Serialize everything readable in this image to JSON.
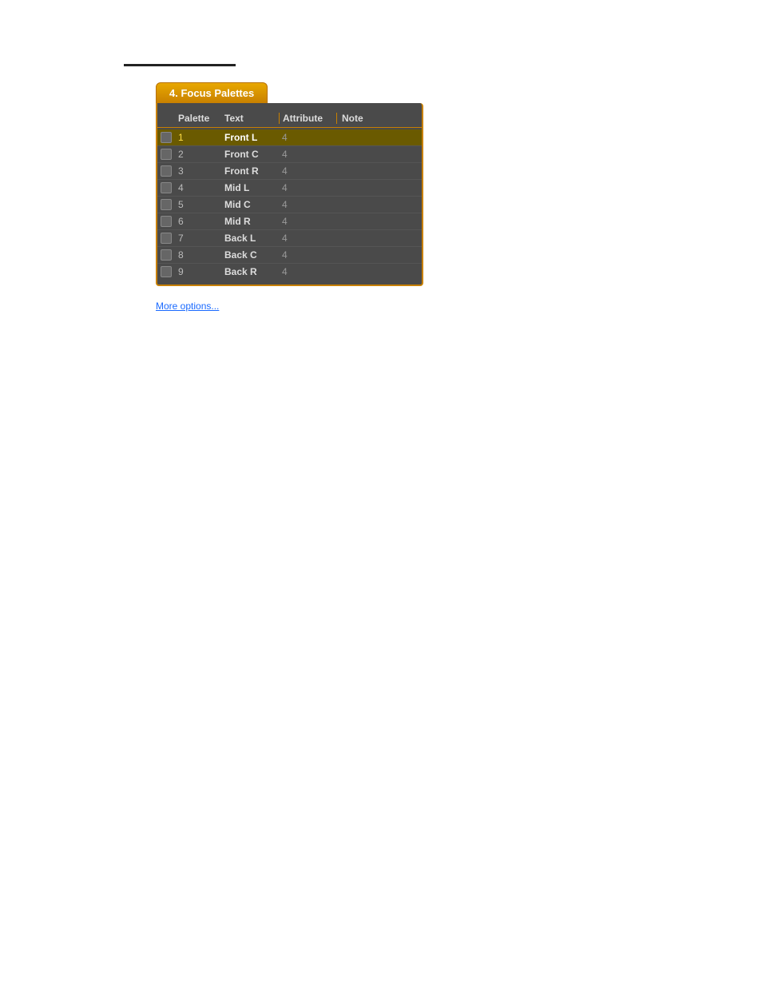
{
  "page": {
    "background_color": "#ffffff"
  },
  "panel": {
    "tab_label": "4. Focus Palettes",
    "columns": {
      "palette": "Palette",
      "text": "Text",
      "attribute": "Attribute",
      "note": "Note"
    },
    "rows": [
      {
        "id": 1,
        "palette": "1",
        "text": "Front L",
        "attribute": "4",
        "selected": true
      },
      {
        "id": 2,
        "palette": "2",
        "text": "Front C",
        "attribute": "4",
        "selected": false
      },
      {
        "id": 3,
        "palette": "3",
        "text": "Front R",
        "attribute": "4",
        "selected": false
      },
      {
        "id": 4,
        "palette": "4",
        "text": "Mid L",
        "attribute": "4",
        "selected": false
      },
      {
        "id": 5,
        "palette": "5",
        "text": "Mid C",
        "attribute": "4",
        "selected": false
      },
      {
        "id": 6,
        "palette": "6",
        "text": "Mid R",
        "attribute": "4",
        "selected": false
      },
      {
        "id": 7,
        "palette": "7",
        "text": "Back L",
        "attribute": "4",
        "selected": false
      },
      {
        "id": 8,
        "palette": "8",
        "text": "Back C",
        "attribute": "4",
        "selected": false
      },
      {
        "id": 9,
        "palette": "9",
        "text": "Back R",
        "attribute": "4",
        "selected": false
      }
    ]
  },
  "top_line": true,
  "bottom_link_label": "More options..."
}
